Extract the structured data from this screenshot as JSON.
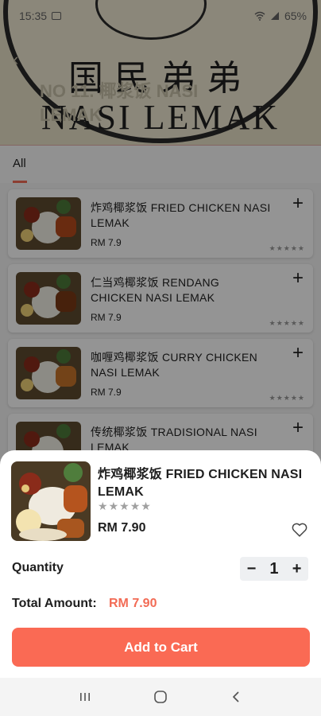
{
  "status_bar": {
    "time": "15:35",
    "battery": "65%"
  },
  "header": {
    "title": "NO 11. 椰浆饭 NASI LEMAK",
    "banner_cn": "国民弟弟",
    "banner_en": "NASI LEMAK"
  },
  "tabs": [
    {
      "label": "All",
      "active": true
    }
  ],
  "menu_items": [
    {
      "name": "炸鸡椰浆饭 FRIED CHICKEN NASI LEMAK",
      "price": "RM 7.9"
    },
    {
      "name": "仁当鸡椰浆饭 RENDANG CHICKEN NASI LEMAK",
      "price": "RM 7.9"
    },
    {
      "name": "咖喱鸡椰浆饭 CURRY CHICKEN NASI LEMAK",
      "price": "RM 7.9"
    },
    {
      "name": "传统椰浆饭 TRADISIONAL NASI LEMAK",
      "price": ""
    }
  ],
  "sheet": {
    "item_name": "炸鸡椰浆饭 FRIED CHICKEN NASI LEMAK",
    "rating": 0,
    "price": "RM 7.90",
    "quantity_label": "Quantity",
    "quantity": "1",
    "total_label": "Total Amount:",
    "total_value": "RM 7.90",
    "add_button": "Add to Cart"
  },
  "colors": {
    "accent": "#fa6a54",
    "accent_text": "#f26b55",
    "stepper_bg": "#eef0f2"
  },
  "icons": {
    "plus": "plus-icon",
    "heart": "heart-outline-icon",
    "star": "star-icon",
    "minus": "minus-icon",
    "nav_recents": "recents-icon",
    "nav_home": "home-icon",
    "nav_back": "back-icon"
  }
}
